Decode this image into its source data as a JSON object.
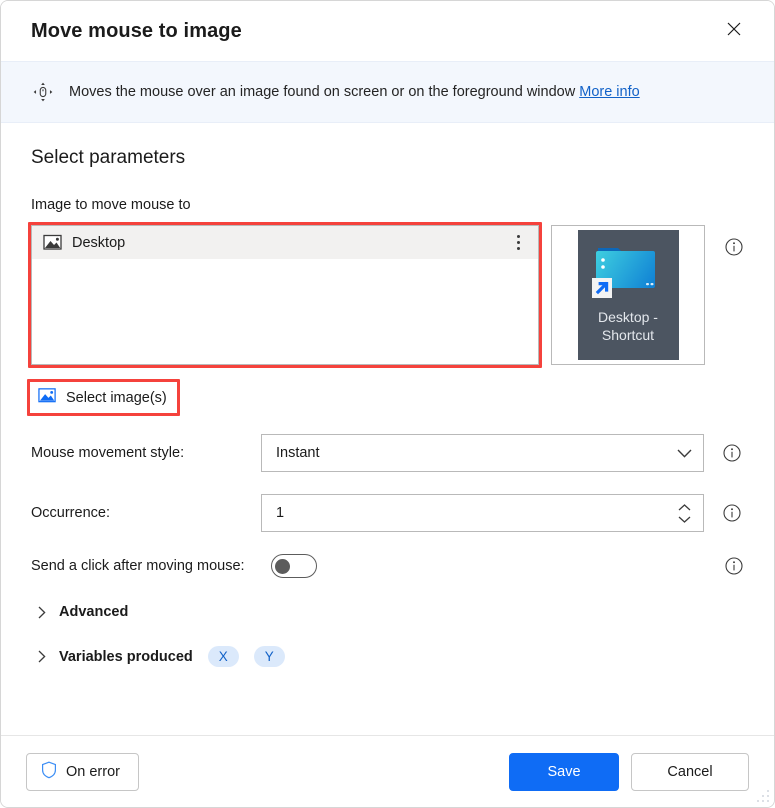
{
  "window": {
    "title": "Move mouse to image",
    "close_icon": "close-icon"
  },
  "banner": {
    "icon": "move-mouse-icon",
    "text": "Moves the mouse over an image found on screen or on the foreground window",
    "link_label": "More info"
  },
  "main": {
    "section_title": "Select parameters",
    "image_field_label": "Image to move mouse to",
    "image_list": {
      "items": [
        {
          "icon": "image-icon",
          "name": "Desktop",
          "menu_icon": "kebab-menu-icon"
        }
      ]
    },
    "thumbnail": {
      "icon": "folder-shortcut-icon",
      "caption_line1": "Desktop -",
      "caption_line2": "Shortcut"
    },
    "select_images_button": {
      "icon": "picture-icon",
      "label": "Select image(s)"
    },
    "fields": [
      {
        "label": "Mouse movement style:",
        "value": "Instant",
        "control": "dropdown",
        "info_icon": "info-icon"
      },
      {
        "label": "Occurrence:",
        "value": "1",
        "control": "spinner",
        "info_icon": "info-icon"
      },
      {
        "label": "Send a click after moving mouse:",
        "value": "off",
        "control": "toggle",
        "info_icon": "info-icon"
      }
    ],
    "expanders": [
      {
        "label": "Advanced",
        "caret": "chevron-right-icon"
      },
      {
        "label": "Variables produced",
        "caret": "chevron-right-icon"
      }
    ],
    "variables": [
      "X",
      "Y"
    ]
  },
  "footer": {
    "on_error_label": "On error",
    "on_error_icon": "shield-icon",
    "save_label": "Save",
    "cancel_label": "Cancel"
  },
  "colors": {
    "accent": "#0f6cf5",
    "link": "#1262c8",
    "banner_bg": "#f3f7fd",
    "highlight": "#f5423c",
    "pill_bg": "#dbe9fb",
    "thumb_bg": "#4c5561"
  }
}
